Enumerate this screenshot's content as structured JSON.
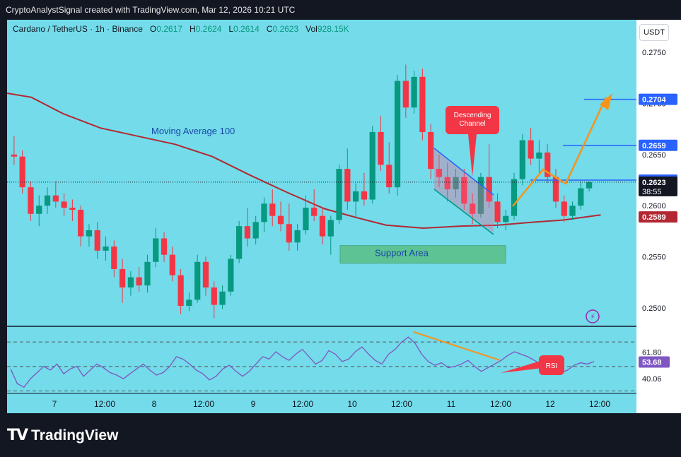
{
  "header": {
    "title": "CryptoAnalystSignal created with TradingView.com, Mar 12, 2026 10:21 UTC"
  },
  "legend": {
    "symbol": "Cardano / TetherUS · 1h · Binance",
    "o_label": "O",
    "o_value": "0.2617",
    "h_label": "H",
    "h_value": "0.2624",
    "l_label": "L",
    "l_value": "0.2614",
    "c_label": "C",
    "c_value": "0.2623",
    "vol_label": "Vol",
    "vol_value": "928.15K"
  },
  "currency_button": "USDT",
  "footer": {
    "brand": "TradingView"
  },
  "colors": {
    "background": "#73dbe9",
    "up": "#089981",
    "down": "#f23645",
    "ma": "#b22833",
    "rsi": "#7e57c2",
    "annotation_orange": "#f7931a",
    "level_blue": "#2962ff"
  },
  "chart_data": [
    {
      "type": "candlestick",
      "title": "Cardano / TetherUS · 1h · Binance",
      "x_ticks": [
        "7",
        "12:00",
        "8",
        "12:00",
        "9",
        "12:00",
        "10",
        "12:00",
        "11",
        "12:00",
        "12",
        "12:00"
      ],
      "y_ticks": [
        "0.2750",
        "0.2700",
        "0.2650",
        "0.2600",
        "0.2550",
        "0.2500"
      ],
      "ylim": [
        0.2482,
        0.2768
      ],
      "price_labels": [
        {
          "value": 0.2704,
          "text": "0.2704",
          "color": "#2962ff"
        },
        {
          "value": 0.2659,
          "text": "0.2659",
          "color": "#2962ff"
        },
        {
          "value": 0.2625,
          "text": "0.2625",
          "color": "#2962ff"
        },
        {
          "value": 0.2623,
          "text": "0.2623",
          "countdown": "38:55",
          "color": "#131722"
        },
        {
          "value": 0.2589,
          "text": "0.2589",
          "color": "#b22833"
        }
      ],
      "horizontal_levels": [
        0.2704,
        0.2659,
        0.2625
      ],
      "annotations": {
        "moving_average": "Moving Average 100",
        "support": "Support Area",
        "descending_channel": "Descending Channel"
      },
      "support_zone": [
        0.2552,
        0.2561
      ],
      "ma_points": [
        [
          0,
          0.271
        ],
        [
          1.3,
          0.2706
        ],
        [
          3.0,
          0.269
        ],
        [
          5.0,
          0.2676
        ],
        [
          7.0,
          0.2668
        ],
        [
          9.0,
          0.266
        ],
        [
          11.0,
          0.2648
        ],
        [
          13.0,
          0.263
        ],
        [
          15.0,
          0.2613
        ],
        [
          17.0,
          0.2597
        ],
        [
          18.8,
          0.2588
        ],
        [
          20.3,
          0.2581
        ],
        [
          22.3,
          0.2578
        ],
        [
          24.3,
          0.258
        ],
        [
          26.3,
          0.2581
        ],
        [
          28.3,
          0.2584
        ],
        [
          29.8,
          0.2586
        ],
        [
          31.8,
          0.2591
        ]
      ],
      "candles_ohlc": [
        [
          0.265,
          0.2668,
          0.264,
          0.2648
        ],
        [
          0.2648,
          0.2654,
          0.2612,
          0.2618
        ],
        [
          0.2618,
          0.2624,
          0.2585,
          0.2592
        ],
        [
          0.2592,
          0.261,
          0.258,
          0.26
        ],
        [
          0.26,
          0.2618,
          0.2592,
          0.261
        ],
        [
          0.261,
          0.2624,
          0.2598,
          0.2604
        ],
        [
          0.2604,
          0.2612,
          0.259,
          0.2598
        ],
        [
          0.2598,
          0.2606,
          0.2585,
          0.2596
        ],
        [
          0.2596,
          0.26,
          0.256,
          0.257
        ],
        [
          0.257,
          0.2582,
          0.256,
          0.2576
        ],
        [
          0.2576,
          0.2584,
          0.2548,
          0.2556
        ],
        [
          0.2556,
          0.257,
          0.2546,
          0.256
        ],
        [
          0.256,
          0.2566,
          0.253,
          0.2538
        ],
        [
          0.2538,
          0.2548,
          0.2505,
          0.252
        ],
        [
          0.252,
          0.2536,
          0.2512,
          0.253
        ],
        [
          0.253,
          0.254,
          0.2516,
          0.2522
        ],
        [
          0.2522,
          0.2552,
          0.2515,
          0.2545
        ],
        [
          0.2545,
          0.2578,
          0.254,
          0.2568
        ],
        [
          0.2568,
          0.2574,
          0.2545,
          0.2552
        ],
        [
          0.2552,
          0.256,
          0.2526,
          0.2532
        ],
        [
          0.2532,
          0.2538,
          0.2494,
          0.2502
        ],
        [
          0.2502,
          0.2515,
          0.2497,
          0.2508
        ],
        [
          0.2508,
          0.2552,
          0.2505,
          0.2545
        ],
        [
          0.2545,
          0.255,
          0.2512,
          0.252
        ],
        [
          0.252,
          0.2526,
          0.249,
          0.2503
        ],
        [
          0.2503,
          0.2522,
          0.2499,
          0.2516
        ],
        [
          0.2516,
          0.2552,
          0.2512,
          0.2548
        ],
        [
          0.2548,
          0.2585,
          0.2544,
          0.258
        ],
        [
          0.258,
          0.2598,
          0.256,
          0.2568
        ],
        [
          0.2568,
          0.259,
          0.2562,
          0.2584
        ],
        [
          0.2584,
          0.2608,
          0.2574,
          0.2602
        ],
        [
          0.2602,
          0.2616,
          0.258,
          0.259
        ],
        [
          0.259,
          0.2604,
          0.2575,
          0.2582
        ],
        [
          0.2582,
          0.2602,
          0.2556,
          0.2564
        ],
        [
          0.2564,
          0.2582,
          0.2556,
          0.2576
        ],
        [
          0.2576,
          0.261,
          0.2572,
          0.2598
        ],
        [
          0.2598,
          0.2616,
          0.2585,
          0.259
        ],
        [
          0.259,
          0.2598,
          0.2562,
          0.257
        ],
        [
          0.257,
          0.259,
          0.2552,
          0.2586
        ],
        [
          0.2586,
          0.264,
          0.2582,
          0.2636
        ],
        [
          0.2636,
          0.2656,
          0.2596,
          0.2604
        ],
        [
          0.2604,
          0.2622,
          0.2588,
          0.2614
        ],
        [
          0.2614,
          0.2632,
          0.26,
          0.2606
        ],
        [
          0.2606,
          0.2678,
          0.2602,
          0.2672
        ],
        [
          0.2672,
          0.2688,
          0.2634,
          0.264
        ],
        [
          0.264,
          0.2662,
          0.2612,
          0.2618
        ],
        [
          0.2618,
          0.2728,
          0.261,
          0.2722
        ],
        [
          0.2722,
          0.2738,
          0.2686,
          0.2696
        ],
        [
          0.2696,
          0.2732,
          0.269,
          0.2726
        ],
        [
          0.2726,
          0.2734,
          0.2664,
          0.2672
        ],
        [
          0.2672,
          0.268,
          0.2626,
          0.2636
        ],
        [
          0.2636,
          0.265,
          0.2618,
          0.2628
        ],
        [
          0.2628,
          0.2642,
          0.2604,
          0.2616
        ],
        [
          0.2616,
          0.2636,
          0.2608,
          0.2628
        ],
        [
          0.2628,
          0.2636,
          0.2596,
          0.2602
        ],
        [
          0.2602,
          0.2612,
          0.2582,
          0.2592
        ],
        [
          0.2592,
          0.2632,
          0.2588,
          0.2628
        ],
        [
          0.2628,
          0.266,
          0.2598,
          0.2604
        ],
        [
          0.2604,
          0.2612,
          0.2578,
          0.2584
        ],
        [
          0.2584,
          0.2596,
          0.2576,
          0.259
        ],
        [
          0.259,
          0.2632,
          0.2586,
          0.2626
        ],
        [
          0.2626,
          0.267,
          0.262,
          0.2664
        ],
        [
          0.2664,
          0.2676,
          0.264,
          0.2646
        ],
        [
          0.2646,
          0.2664,
          0.2632,
          0.2652
        ],
        [
          0.2652,
          0.266,
          0.2622,
          0.2628
        ],
        [
          0.2628,
          0.2636,
          0.2598,
          0.2604
        ],
        [
          0.2604,
          0.261,
          0.2584,
          0.259
        ],
        [
          0.259,
          0.2604,
          0.2586,
          0.26
        ],
        [
          0.26,
          0.2624,
          0.2596,
          0.2617
        ],
        [
          0.2617,
          0.2624,
          0.2614,
          0.2623
        ]
      ]
    },
    {
      "type": "line",
      "title": "RSI",
      "y_ticks": [
        "61.80",
        "40.06"
      ],
      "current_value": "53.68",
      "levels": [
        70,
        50,
        30
      ],
      "ylim": [
        28,
        77
      ],
      "rsi_values": [
        48,
        36,
        33,
        40,
        45,
        50,
        47,
        52,
        44,
        48,
        50,
        42,
        47,
        52,
        49,
        45,
        43,
        40,
        44,
        48,
        52,
        47,
        43,
        45,
        50,
        58,
        56,
        52,
        47,
        44,
        39,
        42,
        48,
        51,
        46,
        42,
        46,
        52,
        58,
        56,
        62,
        58,
        55,
        60,
        64,
        58,
        52,
        55,
        63,
        60,
        54,
        56,
        62,
        66,
        60,
        55,
        52,
        60,
        64,
        70,
        74,
        69,
        60,
        54,
        51,
        53,
        49,
        50,
        52,
        55,
        50,
        46,
        49,
        52,
        55,
        59,
        62,
        60,
        58,
        55,
        52,
        49,
        47,
        45,
        47,
        51,
        53,
        52,
        54
      ],
      "annotation": "RSI"
    }
  ]
}
